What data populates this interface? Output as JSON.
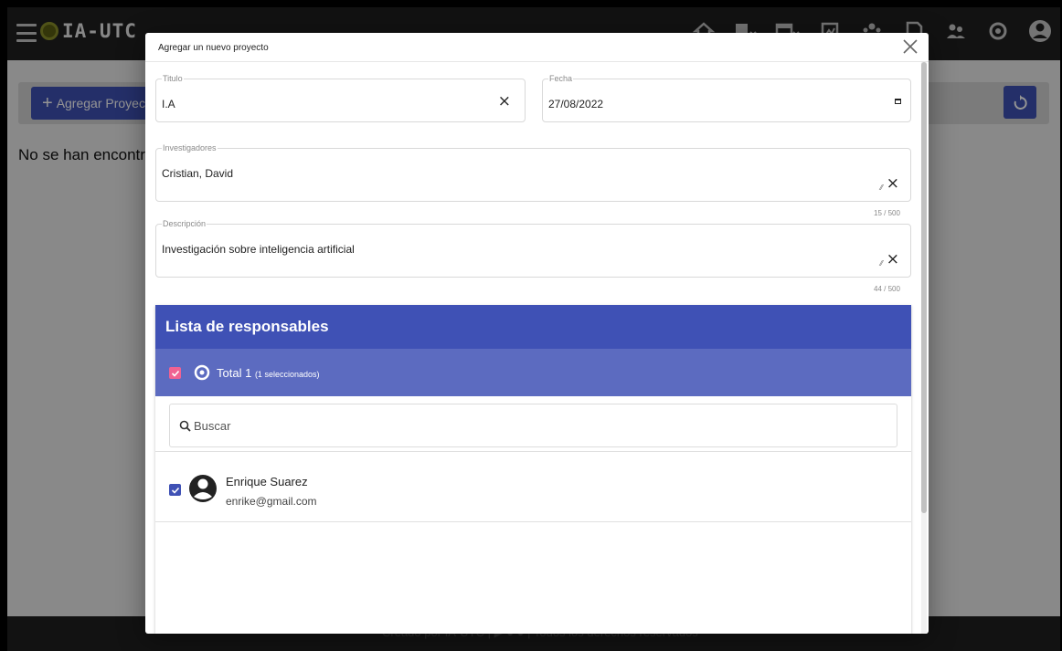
{
  "app": {
    "brand": "IA-UTC",
    "add_project_label": "Agregar Proyecto",
    "no_results": "No se han encontrad",
    "footer_text": "Creado por IA-UTC |  ▶  ●  ●  | Todos los derechos reservados",
    "top_icons": [
      "home-icon",
      "book-menu-icon",
      "calendar-menu-icon",
      "image-icon",
      "group-icon",
      "document-icon",
      "users-icon",
      "eye-icon",
      "user-account-icon"
    ]
  },
  "dialog": {
    "title": "Agregar un nuevo proyecto",
    "fields": {
      "titulo": {
        "label": "Titulo",
        "value": "I.A"
      },
      "fecha": {
        "label": "Fecha",
        "value": "27/08/2022"
      },
      "investigadores": {
        "label": "Investigadores",
        "value": "Cristian, David",
        "counter": "15 / 500"
      },
      "descripcion": {
        "label": "Descripción",
        "value": "Investigación sobre inteligencia artificial",
        "counter": "44 / 500"
      }
    },
    "responsables": {
      "title": "Lista de responsables",
      "total_label": "Total 1",
      "selected_label": "(1 seleccionados)",
      "search_placeholder": "Buscar",
      "users": [
        {
          "name": "Enrique Suarez",
          "email": "enrike@gmail.com",
          "selected": true
        }
      ]
    }
  },
  "colors": {
    "primary": "#3f51b5",
    "primary_light": "#5c6bc0",
    "accent": "#f06292",
    "topbar": "#202020"
  }
}
